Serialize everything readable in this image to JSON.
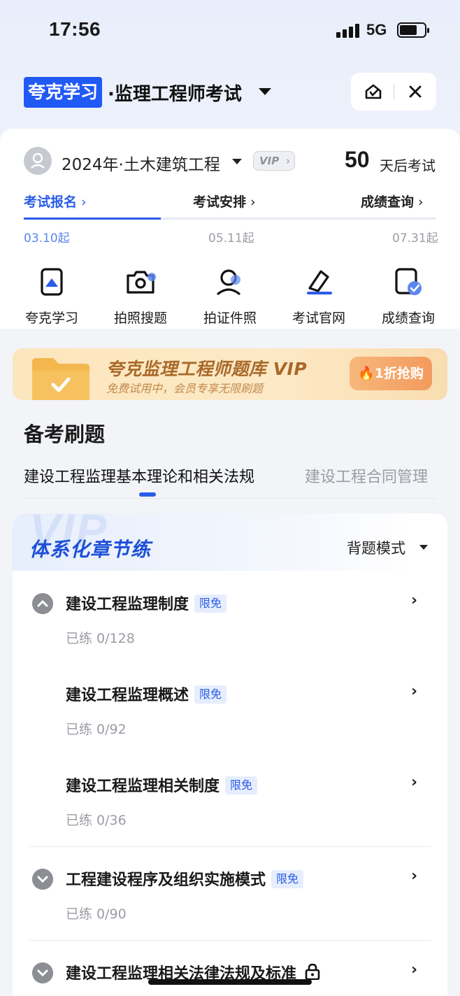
{
  "status_bar": {
    "time": "17:56",
    "network": "5G"
  },
  "header": {
    "brand": "夸克学习",
    "title": "·监理工程师考试"
  },
  "exam": {
    "subject": "2024年·土木建筑工程",
    "vip_label": "VIP",
    "countdown_days": "50",
    "countdown_text": "天后考试"
  },
  "timeline": [
    {
      "label": "考试报名",
      "date": "03.10起",
      "active": true
    },
    {
      "label": "考试安排",
      "date": "05.11起",
      "active": false
    },
    {
      "label": "成绩查询",
      "date": "07.31起",
      "active": false
    }
  ],
  "tools": [
    {
      "label": "夸克学习",
      "icon": "quark-learn-icon"
    },
    {
      "label": "拍照搜题",
      "icon": "camera-icon"
    },
    {
      "label": "拍证件照",
      "icon": "id-photo-icon"
    },
    {
      "label": "考试官网",
      "icon": "official-site-icon"
    },
    {
      "label": "成绩查询",
      "icon": "score-query-icon"
    }
  ],
  "vip_banner": {
    "title": "夸克监理工程师题库 VIP",
    "subtitle": "免费试用中，会员专享无限刷题",
    "button": "1折抢购"
  },
  "practice": {
    "section_title": "备考刷题",
    "subject_tabs": [
      "建设工程监理基本理论和相关法规",
      "建设工程合同管理"
    ],
    "list_watermark": "VIP",
    "list_title": "体系化章节练",
    "mode": "背题模式",
    "items": [
      {
        "name": "建设工程监理制度",
        "tag": "限免",
        "progress": "已练 0/128",
        "toggle": "up"
      },
      {
        "name": "建设工程监理概述",
        "tag": "限免",
        "progress": "已练 0/92",
        "toggle": null
      },
      {
        "name": "建设工程监理相关制度",
        "tag": "限免",
        "progress": "已练 0/36",
        "toggle": null
      },
      {
        "name": "工程建设程序及组织实施模式",
        "tag": "限免",
        "progress": "已练 0/90",
        "toggle": "down"
      },
      {
        "name": "建设工程监理相关法律法规及标准",
        "tag": "",
        "progress": "",
        "toggle": "down",
        "locked": true
      }
    ]
  },
  "colors": {
    "accent": "#2a5ce8",
    "brand": "#2159f5",
    "vip_gold": "#a9692a"
  }
}
